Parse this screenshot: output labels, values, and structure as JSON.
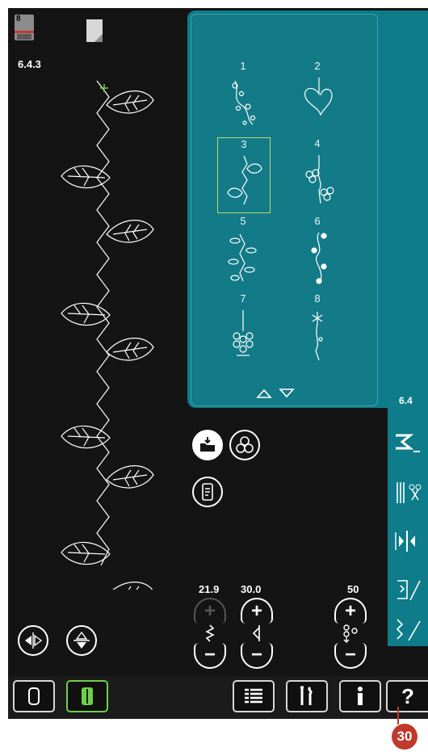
{
  "status": {
    "foot_number": "8",
    "stitch_code": "6.4.3"
  },
  "menu": {
    "items": [
      {
        "label": "1",
        "icon": "floral-vine-stitch-icon"
      },
      {
        "label": "2",
        "icon": "heart-stitch-icon"
      },
      {
        "label": "3",
        "icon": "leaf-vine-stitch-icon"
      },
      {
        "label": "4",
        "icon": "flower-vine-stitch-icon"
      },
      {
        "label": "5",
        "icon": "leaf-branch-stitch-icon"
      },
      {
        "label": "6",
        "icon": "dot-vine-stitch-icon"
      },
      {
        "label": "7",
        "icon": "daisy-stitch-icon"
      },
      {
        "label": "8",
        "icon": "star-vine-stitch-icon"
      }
    ],
    "selected": "3",
    "category_label": "6.4"
  },
  "params": {
    "width": "21.9",
    "length": "30.0",
    "density": "50"
  },
  "colors": {
    "teal": "#0e7c8a",
    "selected_border": "#b9d96b",
    "active_green": "#6fcf4a",
    "callout": "#c0392b"
  },
  "callout": {
    "number": "30"
  },
  "bottom_bar": {
    "help_label": "?"
  }
}
